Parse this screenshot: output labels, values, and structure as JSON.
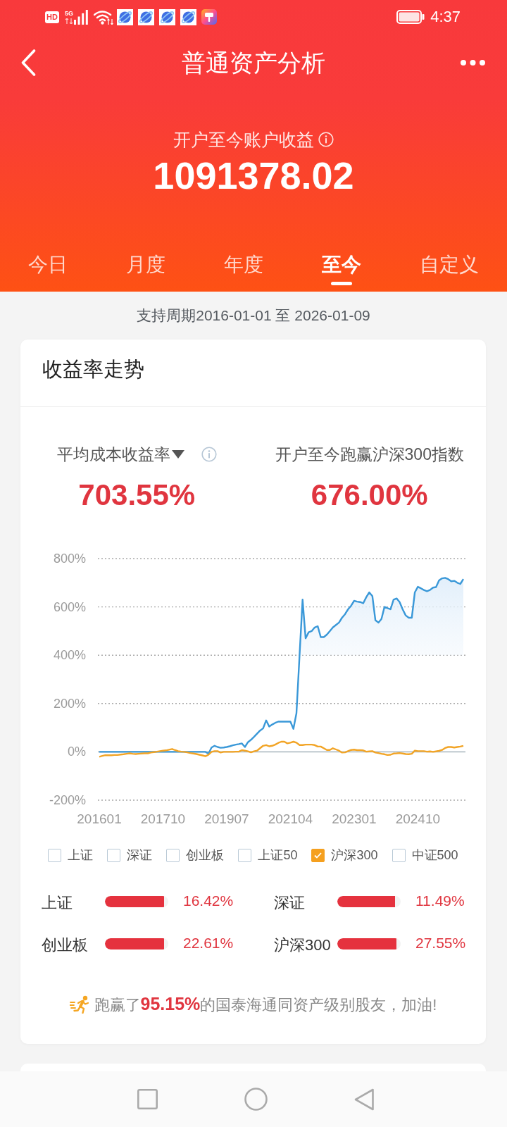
{
  "status_bar": {
    "indicators": [
      {
        "kind": "badge",
        "text": "HD"
      },
      {
        "kind": "network",
        "text": "5G"
      }
    ],
    "time": "4:37"
  },
  "header": {
    "title": "普通资产分析",
    "summary_label": "开户至今账户收益",
    "summary_value": "1091378.02"
  },
  "tabs": [
    {
      "label": "今日",
      "selected": false
    },
    {
      "label": "月度",
      "selected": false
    },
    {
      "label": "年度",
      "selected": false
    },
    {
      "label": "至今",
      "selected": true
    },
    {
      "label": "自定义",
      "selected": false
    }
  ],
  "period": "支持周期2016-01-01 至 2026-01-09",
  "trend_card": {
    "title": "收益率走势",
    "metrics": [
      {
        "kind": "dropdown",
        "label": "平均成本收益率",
        "value": "703.55%"
      },
      {
        "kind": "plain",
        "label": "开户至今跑赢沪深300指数",
        "value": "676.00%"
      }
    ],
    "chart_data": {
      "type": "line",
      "grid": true,
      "categories": [
        "201601",
        null,
        null,
        null,
        null,
        null,
        null,
        null,
        null,
        null,
        null,
        null,
        null,
        null,
        null,
        null,
        null,
        null,
        null,
        null,
        null,
        "201710",
        null,
        null,
        null,
        null,
        null,
        null,
        null,
        null,
        null,
        null,
        null,
        null,
        null,
        null,
        null,
        null,
        null,
        null,
        null,
        null,
        "201907",
        null,
        null,
        null,
        null,
        null,
        null,
        null,
        null,
        null,
        null,
        null,
        null,
        null,
        null,
        null,
        null,
        null,
        null,
        null,
        null,
        "202104",
        null,
        null,
        null,
        null,
        null,
        null,
        null,
        null,
        null,
        null,
        null,
        null,
        null,
        null,
        null,
        null,
        null,
        null,
        null,
        null,
        "202301",
        null,
        null,
        null,
        null,
        null,
        null,
        null,
        null,
        null,
        null,
        null,
        null,
        null,
        null,
        null,
        null,
        null,
        null,
        null,
        null,
        "202410",
        null,
        null,
        null,
        null,
        null,
        null,
        null,
        null,
        null,
        null,
        null,
        null,
        null,
        null,
        null
      ],
      "series": [
        {
          "color": "#3a98d8",
          "values": [
            0,
            0,
            0,
            0,
            0,
            0,
            0,
            0,
            0,
            0,
            0,
            0,
            0,
            0,
            0,
            0,
            0,
            0,
            0,
            0,
            0,
            0,
            0,
            0,
            0,
            0,
            0,
            0,
            0,
            0,
            0,
            0,
            0,
            0,
            0,
            0,
            -8,
            18,
            25,
            20,
            17,
            18,
            20,
            23,
            27,
            30,
            32,
            35,
            20,
            40,
            50,
            62,
            75,
            88,
            97,
            130,
            105,
            113,
            120,
            125,
            125,
            125,
            125,
            125,
            95,
            160,
            400,
            630,
            470,
            495,
            500,
            515,
            520,
            475,
            475,
            485,
            500,
            515,
            525,
            535,
            555,
            570,
            590,
            605,
            625,
            622,
            620,
            615,
            640,
            660,
            645,
            545,
            535,
            550,
            600,
            595,
            590,
            630,
            635,
            620,
            590,
            565,
            555,
            555,
            660,
            683,
            677,
            670,
            665,
            670,
            680,
            682,
            710,
            718,
            720,
            715,
            706,
            708,
            700,
            695,
            715
          ]
        },
        {
          "color": "#f2a425",
          "values": [
            -20,
            -17,
            -14,
            -14,
            -14,
            -13,
            -13,
            -11,
            -10,
            -8,
            -6,
            -8,
            -9,
            -8,
            -7,
            -6,
            -6,
            -3,
            -1,
            1,
            3,
            5,
            6,
            9,
            12,
            7,
            3,
            1,
            0,
            -2,
            -5,
            -7,
            -9,
            -12,
            -15,
            -18,
            -12,
            0,
            3,
            3,
            -3,
            0,
            0,
            0,
            0,
            1,
            1,
            7,
            5,
            2,
            -2,
            2,
            5,
            15,
            25,
            28,
            23,
            25,
            30,
            37,
            42,
            42,
            35,
            38,
            42,
            38,
            28,
            28,
            30,
            30,
            30,
            28,
            22,
            22,
            15,
            8,
            8,
            15,
            10,
            5,
            -3,
            -2,
            3,
            8,
            9,
            7,
            7,
            6,
            1,
            2,
            3,
            -3,
            -5,
            -8,
            -10,
            -13,
            -12,
            -7,
            -6,
            -5,
            -7,
            -9,
            -10,
            -8,
            5,
            3,
            3,
            3,
            1,
            2,
            0,
            2,
            4,
            8,
            16,
            20,
            20,
            18,
            20,
            22,
            25
          ]
        }
      ],
      "ylim": [
        -200,
        800
      ],
      "yticks": [
        {
          "value": 800,
          "label": "800%"
        },
        {
          "value": 600,
          "label": "600%"
        },
        {
          "value": 400,
          "label": "400%"
        },
        {
          "value": 200,
          "label": "200%"
        },
        {
          "value": 0,
          "label": "0%"
        },
        {
          "value": -200,
          "label": "-200%"
        }
      ]
    },
    "indices": [
      {
        "label": "上证",
        "checked": false
      },
      {
        "label": "深证",
        "checked": false
      },
      {
        "label": "创业板",
        "checked": false
      },
      {
        "label": "上证50",
        "checked": false
      },
      {
        "label": "沪深300",
        "checked": true
      },
      {
        "label": "中证500",
        "checked": false
      }
    ],
    "comparisons": [
      {
        "label": "上证",
        "level": 0.93,
        "value": "16.42%"
      },
      {
        "label": "深证",
        "level": 0.91,
        "value": "11.49%"
      },
      {
        "label": "创业板",
        "level": 0.93,
        "value": "22.61%"
      },
      {
        "label": "沪深300",
        "level": 0.93,
        "value": "27.55%"
      }
    ],
    "footer": "跑赢了**95.15%**的国泰海通同资产级别股友，加油!"
  }
}
